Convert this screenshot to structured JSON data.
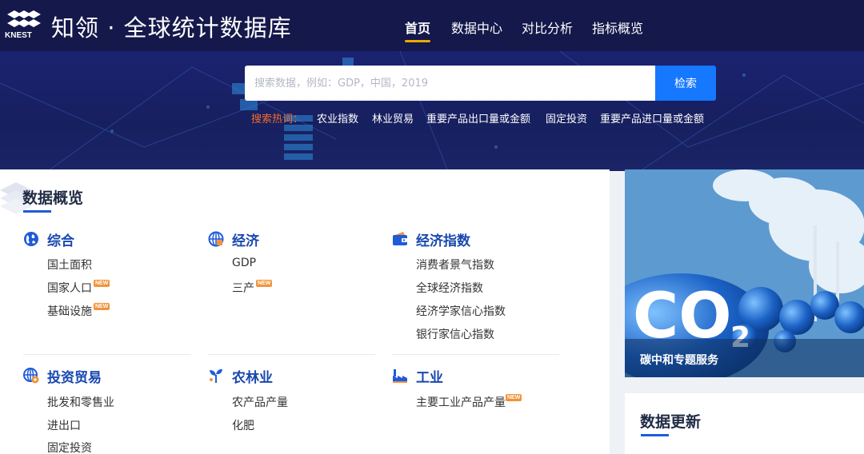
{
  "header": {
    "logo_text": "KNEST",
    "title": "知领 · 全球统计数据库",
    "nav": [
      {
        "label": "首页",
        "active": true
      },
      {
        "label": "数据中心",
        "active": false
      },
      {
        "label": "对比分析",
        "active": false
      },
      {
        "label": "指标概览",
        "active": false
      }
    ]
  },
  "search": {
    "placeholder": "搜索数据，例如：GDP，中国，2019",
    "button_label": "检索",
    "hot_label": "搜索热词：",
    "hot_terms": [
      "农业指数",
      "林业贸易",
      "重要产品出口量或金额",
      "固定投资",
      "重要产品进口量或金额"
    ]
  },
  "overview": {
    "title": "数据概览",
    "new_badge": "NEW",
    "categories": [
      {
        "name": "综合",
        "icon": "globe-icon",
        "items": [
          {
            "label": "国土面积",
            "new": false
          },
          {
            "label": "国家人口",
            "new": true
          },
          {
            "label": "基础设施",
            "new": true
          }
        ]
      },
      {
        "name": "经济",
        "icon": "globe-grid-icon",
        "items": [
          {
            "label": "GDP",
            "new": false
          },
          {
            "label": "三产",
            "new": true
          }
        ]
      },
      {
        "name": "经济指数",
        "icon": "wallet-icon",
        "items": [
          {
            "label": "消费者景气指数",
            "new": false
          },
          {
            "label": "全球经济指数",
            "new": false
          },
          {
            "label": "经济学家信心指数",
            "new": false
          },
          {
            "label": "银行家信心指数",
            "new": false
          }
        ]
      },
      {
        "name": "投资贸易",
        "icon": "globe-gear-icon",
        "items": [
          {
            "label": "批发和零售业",
            "new": false
          },
          {
            "label": "进出口",
            "new": false
          },
          {
            "label": "固定投资",
            "new": false
          }
        ]
      },
      {
        "name": "农林业",
        "icon": "sprout-icon",
        "items": [
          {
            "label": "农产品产量",
            "new": false
          },
          {
            "label": "化肥",
            "new": false
          }
        ]
      },
      {
        "name": "工业",
        "icon": "factory-icon",
        "items": [
          {
            "label": "主要工业产品产量",
            "new": true
          }
        ]
      }
    ]
  },
  "banner": {
    "label": "碳中和专题服务",
    "formula_main": "CO",
    "formula_sub": "2"
  },
  "updates": {
    "title": "数据更新"
  },
  "colors": {
    "header_bg": "#14184a",
    "hero_bg": "#1b2270",
    "accent_blue": "#1677ff",
    "category_blue": "#1848b0",
    "hot_label_orange": "#f26a2e",
    "nav_underline": "#f0a800",
    "new_badge": "#f2933a"
  }
}
